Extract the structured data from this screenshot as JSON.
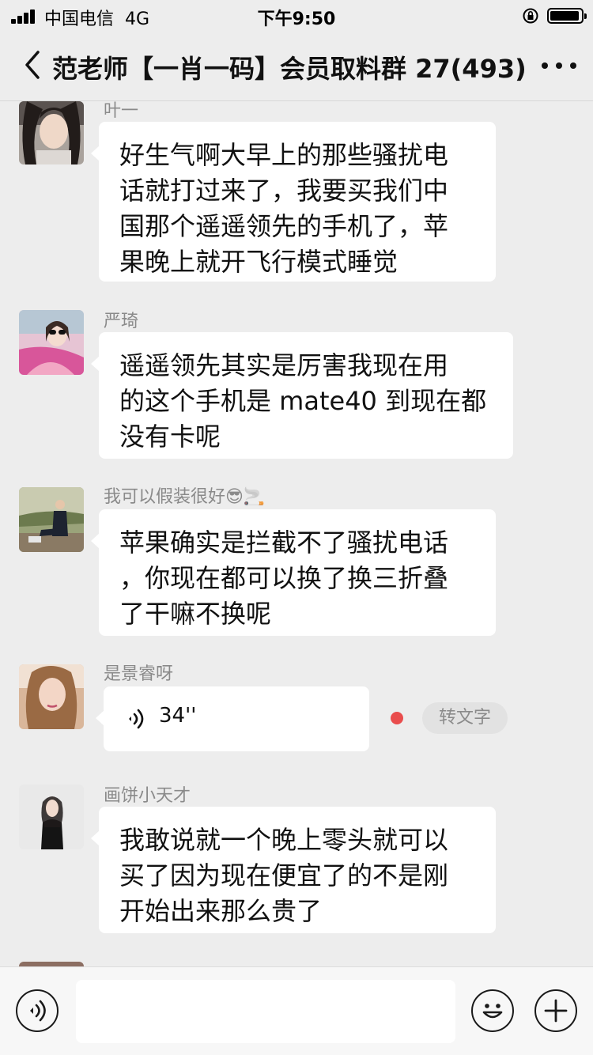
{
  "status_bar": {
    "carrier": "中国电信",
    "network": "4G",
    "time": "下午9:50"
  },
  "nav": {
    "title": "范老师【一肖一码】会员取料群 27(493)"
  },
  "messages": [
    {
      "sender": "叶一",
      "lines": [
        "好生气啊大早上的那些骚扰电",
        "话就打过来了，我要买我们中",
        "国那个遥遥领先的手机了，苹",
        "果晚上就开飞行模式睡觉"
      ]
    },
    {
      "sender": "严琦",
      "lines": [
        "遥遥领先其实是厉害我现在用",
        "的这个手机是 mate40 到现在都",
        "没有卡呢"
      ]
    },
    {
      "sender": "我可以假装很好😎🚬",
      "lines": [
        "苹果确实是拦截不了骚扰电话",
        "，你现在都可以换了换三折叠",
        "了干嘛不换呢"
      ]
    },
    {
      "sender": "是景睿呀",
      "voice_duration": "34''",
      "transcribe_label": "转文字"
    },
    {
      "sender": "画饼小天才",
      "lines": [
        "我敢说就一个晚上零头就可以",
        "买了因为现在便宜了的不是刚",
        "开始出来那么贵了"
      ]
    }
  ],
  "input": {
    "placeholder": ""
  },
  "colors": {
    "background": "#ededed",
    "bubble": "#ffffff",
    "sender_text": "#8a8a8a",
    "unread_dot": "#e94d4d"
  }
}
